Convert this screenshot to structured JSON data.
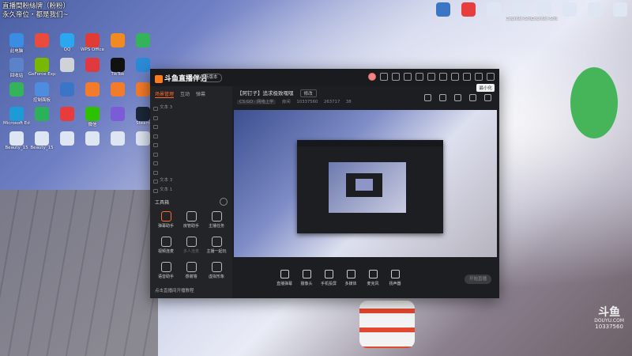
{
  "desktop": {
    "overlay_text": [
      "直播間粉絲牌（粉粉）",
      "永久帝位・都是我们~"
    ],
    "icons_left": [
      {
        "label": "此电脑",
        "color": "#3a8de0"
      },
      {
        "label": "",
        "color": "#e94b3c"
      },
      {
        "label": "QQ",
        "color": "#2aa7f0"
      },
      {
        "label": "WPS Office",
        "color": "#e13b35"
      },
      {
        "label": "",
        "color": "#f28a22"
      },
      {
        "label": "",
        "color": "#35b35a"
      },
      {
        "label": "回收站",
        "color": "#5c83c9"
      },
      {
        "label": "GeForce Experience",
        "color": "#76b900"
      },
      {
        "label": "",
        "color": "#cfd2d6"
      },
      {
        "label": "",
        "color": "#e0393e"
      },
      {
        "label": "TikTok",
        "color": "#111111"
      },
      {
        "label": "",
        "color": "#2b8bd7"
      },
      {
        "label": "",
        "color": "#35b35a"
      },
      {
        "label": "控制面板",
        "color": "#4d8de0"
      },
      {
        "label": "",
        "color": "#3a76c5"
      },
      {
        "label": "",
        "color": "#f37b2a"
      },
      {
        "label": "",
        "color": "#f37b2a"
      },
      {
        "label": "",
        "color": "#f37b2a"
      },
      {
        "label": "Microsoft Edge",
        "color": "#1e9ad6"
      },
      {
        "label": "",
        "color": "#2cb05a"
      },
      {
        "label": "",
        "color": "#e83c3c"
      },
      {
        "label": "微信",
        "color": "#2dc100"
      },
      {
        "label": "",
        "color": "#7b5bd6"
      },
      {
        "label": "Steam",
        "color": "#1b2838"
      },
      {
        "label": "Beauty_15",
        "color": "#dfe6f3"
      },
      {
        "label": "Beauty_15",
        "color": "#dfe6f3"
      },
      {
        "label": "",
        "color": "#dfe6f3"
      },
      {
        "label": "",
        "color": "#dfe6f3"
      },
      {
        "label": "",
        "color": "#dfe6f3"
      },
      {
        "label": "",
        "color": "#dfe6f3"
      }
    ],
    "icons_right": [
      {
        "label": "",
        "color": "#3a76c5"
      },
      {
        "label": "",
        "color": "#e63d3d"
      },
      {
        "label": "",
        "color": "#dfe6f3"
      },
      {
        "label": "Counter-Strike Global Of...",
        "color": "#dfe6f3"
      },
      {
        "label": "Counter-Strike Global Of...",
        "color": "#dfe6f3"
      },
      {
        "label": "",
        "color": "#dfe6f3"
      },
      {
        "label": "",
        "color": "#dfe6f3"
      },
      {
        "label": "",
        "color": "#dfe6f3"
      }
    ]
  },
  "app": {
    "name": "斗鱼直播伴侣",
    "version_badge": "新版本",
    "tooltip": "最小化",
    "left_tabs": [
      "场景管理",
      "互动",
      "弹幕"
    ],
    "scene_items": [
      "文本 3",
      "",
      "",
      "",
      "",
      "",
      "",
      "",
      "文本 3",
      "文本 1"
    ],
    "tools_heading": "工具箱",
    "tools": [
      {
        "label": "弹幕助手",
        "hot": true,
        "dim": false
      },
      {
        "label": "房管助手",
        "hot": false,
        "dim": false
      },
      {
        "label": "主播任务",
        "hot": false,
        "dim": false
      },
      {
        "label": "视频连麦",
        "hot": false,
        "dim": false
      },
      {
        "label": "多人连麦",
        "hot": false,
        "dim": true
      },
      {
        "label": "主播一起玩",
        "hot": false,
        "dim": false
      },
      {
        "label": "语音助手",
        "hot": false,
        "dim": false
      },
      {
        "label": "感谢墙",
        "hot": false,
        "dim": false
      },
      {
        "label": "虚拟形象",
        "hot": false,
        "dim": false
      }
    ],
    "bottom_note": "点击直播间开播教程",
    "room_title": "【阿钉子】追求极致嘿嘿",
    "edit_label": "修改",
    "room_meta": {
      "category": "CS:GO · 网络上学",
      "id_label": "房间",
      "room_id": "10337560",
      "hot": "263717",
      "fans": "38"
    },
    "controls": [
      "直播弹幕",
      "摄像头",
      "手机投屏",
      "多媒体",
      "麦克风",
      "扬声器"
    ],
    "start_live": "开始直播",
    "status": [
      "",
      "",
      "",
      ""
    ]
  },
  "watermark": {
    "logo": "斗鱼",
    "sub": "DOUYU.COM",
    "room_id": "10337560"
  }
}
